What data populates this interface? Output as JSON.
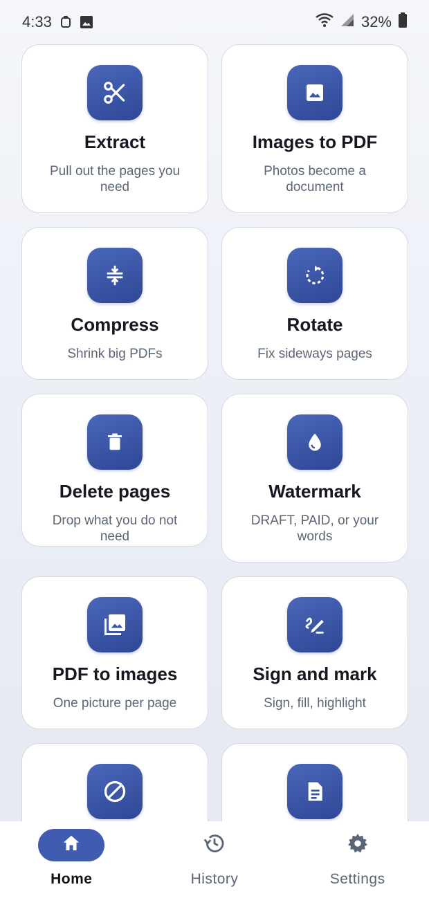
{
  "status_bar": {
    "time": "4:33",
    "battery": "32%",
    "icons": [
      "notification-icon",
      "image-icon",
      "wifi-icon",
      "signal-icon",
      "battery-icon"
    ]
  },
  "tools": [
    {
      "title": "Extract",
      "subtitle": "Pull out the pages you need",
      "icon": "scissors-icon"
    },
    {
      "title": "Images to PDF",
      "subtitle": "Photos become a document",
      "icon": "image-icon"
    },
    {
      "title": "Compress",
      "subtitle": "Shrink big PDFs",
      "icon": "compress-icon"
    },
    {
      "title": "Rotate",
      "subtitle": "Fix sideways pages",
      "icon": "rotate-icon"
    },
    {
      "title": "Delete pages",
      "subtitle": "Drop what you do not need",
      "icon": "trash-icon"
    },
    {
      "title": "Watermark",
      "subtitle": "DRAFT, PAID, or your words",
      "icon": "water-drop-icon"
    },
    {
      "title": "PDF to images",
      "subtitle": "One picture per page",
      "icon": "photo-library-icon"
    },
    {
      "title": "Sign and mark",
      "subtitle": "Sign, fill, highlight",
      "icon": "signature-icon"
    },
    {
      "title": "",
      "subtitle": "",
      "icon": "block-icon"
    },
    {
      "title": "",
      "subtitle": "",
      "icon": "document-icon"
    }
  ],
  "bottom_nav": {
    "items": [
      {
        "label": "Home",
        "icon": "home-icon",
        "active": true
      },
      {
        "label": "History",
        "icon": "history-icon",
        "active": false
      },
      {
        "label": "Settings",
        "icon": "gear-icon",
        "active": false
      }
    ]
  },
  "colors": {
    "accent": "#3f5cb0",
    "tile": "#3a55a8",
    "card_border": "#d4d9e2",
    "subtitle": "#5a6675"
  }
}
